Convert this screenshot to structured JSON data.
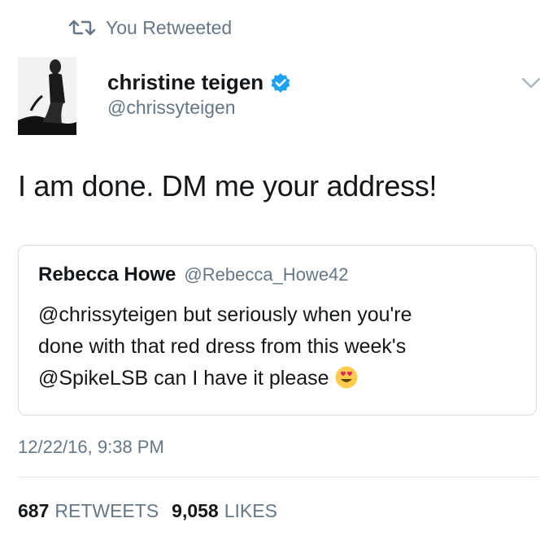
{
  "retweet": {
    "icon": "retweet-icon",
    "label": "You Retweeted"
  },
  "author": {
    "name": "christine teigen",
    "handle": "@chrissyteigen",
    "verified_icon": "verified-badge-icon",
    "verified_color": "#1da1f2"
  },
  "menu": {
    "icon": "chevron-down-icon"
  },
  "tweet": {
    "text": "I am done. DM me your address!"
  },
  "quoted": {
    "name": "Rebecca Howe",
    "handle": "@Rebecca_Howe42",
    "lines": [
      "@chrissyteigen but seriously when you're",
      "done with that red dress from this week's",
      "@SpikeLSB can I have it please"
    ],
    "emoji": "heart-eyes-emoji-icon"
  },
  "timestamp": "12/22/16, 9:38 PM",
  "stats": {
    "retweets_count": "687",
    "retweets_label": "RETWEETS",
    "likes_count": "9,058",
    "likes_label": "LIKES"
  },
  "colors": {
    "text": "#14171a",
    "secondary": "#657786",
    "border": "#d6dde3"
  }
}
